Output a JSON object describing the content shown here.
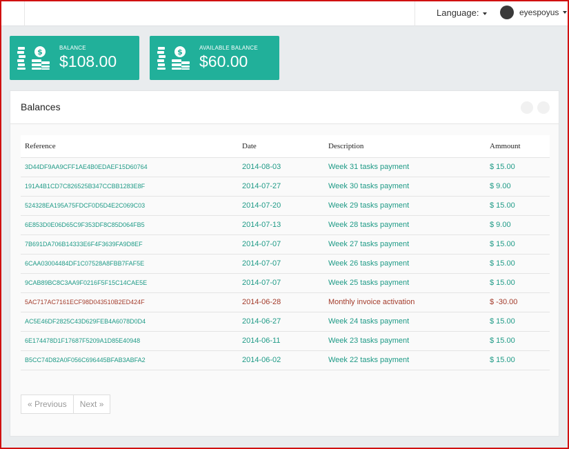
{
  "header": {
    "language_label": "Language:",
    "username": "eyespoyus"
  },
  "cards": [
    {
      "label": "BALANCE",
      "value": "$108.00",
      "icon": "coins-icon"
    },
    {
      "label": "AVAILABLE BALANCE",
      "value": "$60.00",
      "icon": "coins-icon"
    }
  ],
  "panel": {
    "title": "Balances",
    "columns": [
      "Reference",
      "Date",
      "Description",
      "Ammount"
    ],
    "rows": [
      {
        "reference": "3D44DF9AA9CFF1AE4B0EDAEF15D60764",
        "date": "2014-08-03",
        "description": "Week 31 tasks payment",
        "amount": "$ 15.00"
      },
      {
        "reference": "191A4B1CD7C826525B347CCBB1283E8F",
        "date": "2014-07-27",
        "description": "Week 30 tasks payment",
        "amount": "$ 9.00"
      },
      {
        "reference": "524328EA195A75FDCF0D5D4E2C069C03",
        "date": "2014-07-20",
        "description": "Week 29 tasks payment",
        "amount": "$ 15.00"
      },
      {
        "reference": "6E853D0E06D65C9F353DF8C85D064FB5",
        "date": "2014-07-13",
        "description": "Week 28 tasks payment",
        "amount": "$ 9.00"
      },
      {
        "reference": "7B691DA706B14333E6F4F3639FA9D8EF",
        "date": "2014-07-07",
        "description": "Week 27 tasks payment",
        "amount": "$ 15.00"
      },
      {
        "reference": "6CAA03004484DF1C07528A8FBB7FAF5E",
        "date": "2014-07-07",
        "description": "Week 26 tasks payment",
        "amount": "$ 15.00"
      },
      {
        "reference": "9CAB89BC8C3AA9F0216F5F15C14CAE5E",
        "date": "2014-07-07",
        "description": "Week 25 tasks payment",
        "amount": "$ 15.00"
      },
      {
        "reference": "5AC717AC7161ECF98D043510B2ED424F",
        "date": "2014-06-28",
        "description": "Monthly invoice activation",
        "amount": "$ -30.00",
        "negative": true
      },
      {
        "reference": "AC5E46DF2825C43D629FEB4A6078D0D4",
        "date": "2014-06-27",
        "description": "Week 24 tasks payment",
        "amount": "$ 15.00"
      },
      {
        "reference": "6E174478D1F17687F5209A1D85E40948",
        "date": "2014-06-11",
        "description": "Week 23 tasks payment",
        "amount": "$ 15.00"
      },
      {
        "reference": "B5CC74D82A0F056C696445BFAB3ABFA2",
        "date": "2014-06-02",
        "description": "Week 22 tasks payment",
        "amount": "$ 15.00"
      }
    ]
  },
  "pagination": {
    "previous": "« Previous",
    "next": "Next »"
  },
  "colors": {
    "accent": "#21b09a",
    "link": "#1e9a86",
    "negative": "#a33b2b"
  }
}
